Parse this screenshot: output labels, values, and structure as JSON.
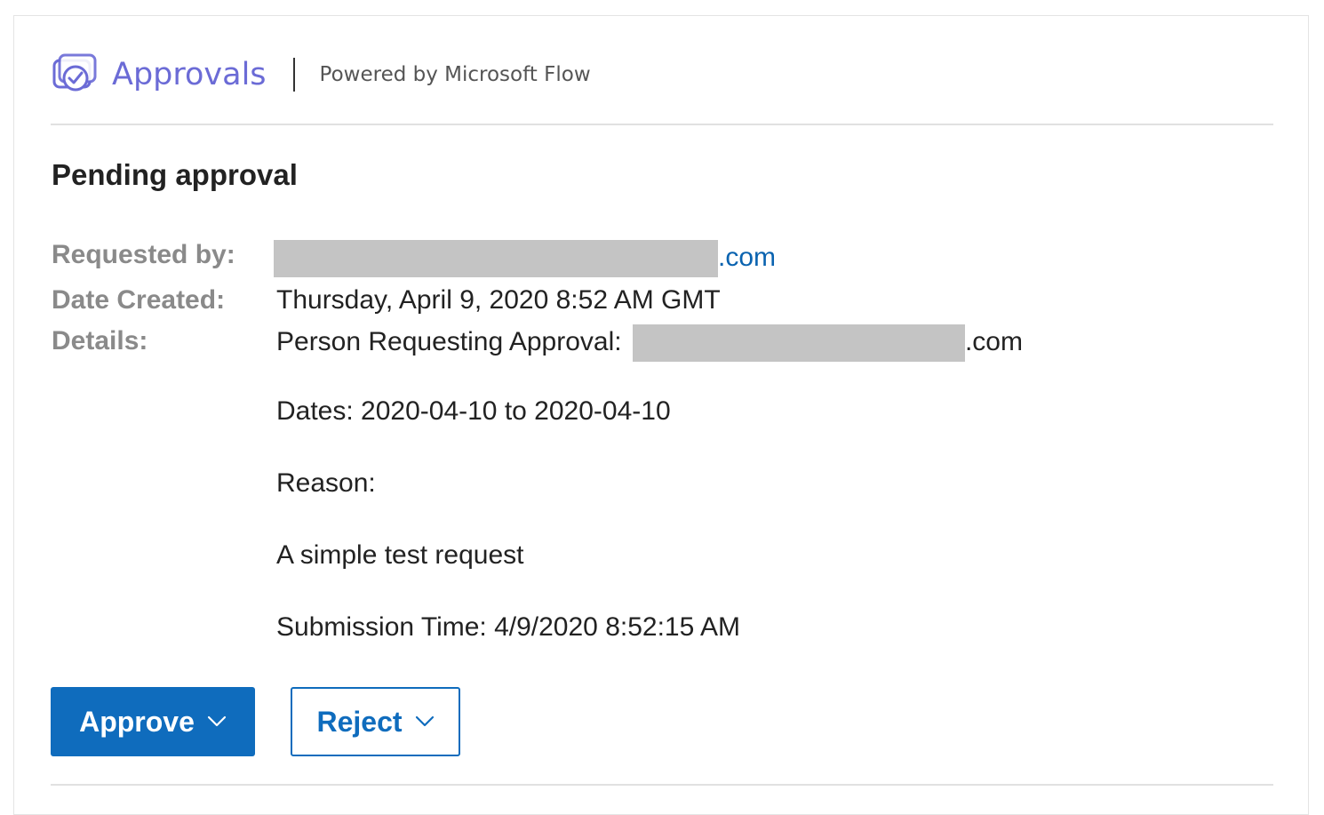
{
  "header": {
    "app_name": "Approvals",
    "powered_by": "Powered by Microsoft Flow",
    "icon": "approvals-check-icon",
    "brand_color": "#6b6bd6"
  },
  "title": "Pending approval",
  "fields": {
    "requested_by_label": "Requested by:",
    "requested_by_suffix": ".com",
    "date_created_label": "Date Created:",
    "date_created_value": "Thursday, April 9, 2020 8:52 AM GMT",
    "details_label": "Details:"
  },
  "details": {
    "person_label": "Person Requesting Approval:",
    "person_suffix": ".com",
    "dates": "Dates: 2020-04-10 to 2020-04-10",
    "reason_label": "Reason:",
    "reason_text": "A simple test request",
    "submission_time": "Submission Time: 4/9/2020 8:52:15 AM"
  },
  "actions": {
    "approve_label": "Approve",
    "reject_label": "Reject",
    "accent_color": "#0f6cbd"
  }
}
